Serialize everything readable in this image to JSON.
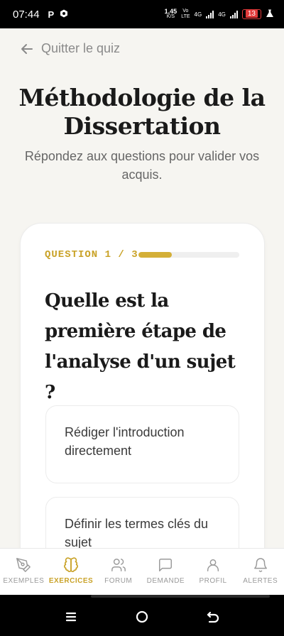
{
  "status": {
    "time": "07:44",
    "app_icon_1": "P",
    "speed_value": "1,45",
    "speed_unit": "K/S",
    "volte_top": "Vo",
    "volte_bottom": "LTE",
    "net1": "4G",
    "net2": "4G",
    "battery": "13"
  },
  "header": {
    "back_label": "Quitter le quiz"
  },
  "page": {
    "title": "Méthodologie de la Dissertation",
    "subtitle": "Répondez aux questions pour valider vos acquis."
  },
  "quiz": {
    "question_label": "QUESTION 1 / 3",
    "progress_fraction": 0.33,
    "question": "Quelle est la première étape de l'analyse d'un sujet ?",
    "options": [
      "Rédiger l'introduction directement",
      "Définir les termes clés du sujet"
    ]
  },
  "nav": {
    "items": [
      {
        "label": "EXEMPLES",
        "icon": "pen-nib-icon"
      },
      {
        "label": "EXERCICES",
        "icon": "brain-icon"
      },
      {
        "label": "FORUM",
        "icon": "users-icon"
      },
      {
        "label": "DEMANDE",
        "icon": "chat-bubble-icon"
      },
      {
        "label": "PROFIL",
        "icon": "user-icon"
      },
      {
        "label": "ALERTES",
        "icon": "bell-icon"
      }
    ],
    "active_index": 1
  },
  "colors": {
    "accent": "#d4af37",
    "accent_text": "#c9a227",
    "background": "#f6f5f1"
  }
}
